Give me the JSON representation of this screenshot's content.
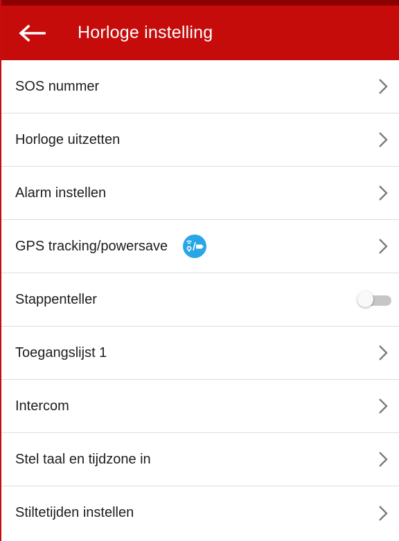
{
  "header": {
    "title": "Horloge instelling",
    "back_icon": "arrow-left-icon",
    "background_color": "#c60b0b"
  },
  "items": [
    {
      "label": "SOS nummer",
      "control": "chevron"
    },
    {
      "label": "Horloge uitzetten",
      "control": "chevron"
    },
    {
      "label": "Alarm instellen",
      "control": "chevron"
    },
    {
      "label": "GPS tracking/powersave",
      "control": "chevron",
      "badge_icon": "gps-powersave-icon",
      "badge_color": "#2aa6e6"
    },
    {
      "label": "Stappenteller",
      "control": "toggle",
      "toggle_on": false
    },
    {
      "label": "Toegangslijst 1",
      "control": "chevron"
    },
    {
      "label": "Intercom",
      "control": "chevron"
    },
    {
      "label": "Stel taal en tijdzone in",
      "control": "chevron"
    },
    {
      "label": "Stiltetijden instellen",
      "control": "chevron"
    }
  ]
}
